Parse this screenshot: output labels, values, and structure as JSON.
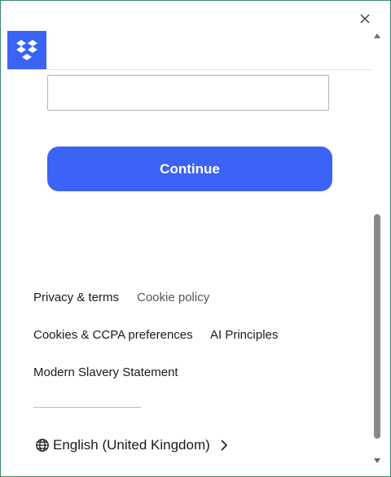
{
  "window": {
    "close_icon": "close-icon"
  },
  "header": {
    "logo_icon": "dropbox-logo-icon",
    "logo_color": "#3b63f5"
  },
  "form": {
    "input_value": "",
    "input_placeholder": "",
    "continue_label": "Continue",
    "continue_color": "#3b63f5"
  },
  "footer": {
    "links": [
      {
        "label": "Privacy & terms"
      },
      {
        "label": "Cookie policy"
      },
      {
        "label": "Cookies & CCPA preferences"
      },
      {
        "label": "AI Principles"
      },
      {
        "label": "Modern Slavery Statement"
      }
    ],
    "language": {
      "label": "English (United Kingdom)",
      "icon": "globe-icon"
    }
  },
  "scrollbar": {
    "thumb_color": "#8a8a8a"
  }
}
